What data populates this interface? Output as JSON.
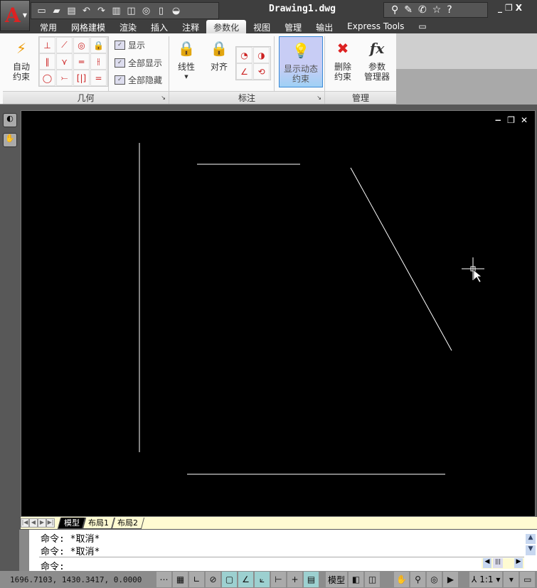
{
  "app": {
    "logo": "A",
    "title": "Drawing1.dwg"
  },
  "qat": {
    "icons": [
      "new-icon",
      "open-icon",
      "save-icon",
      "undo-icon",
      "redo-icon",
      "plot-icon",
      "publish-icon",
      "preview-icon",
      "properties-icon",
      "teapot-icon"
    ],
    "glyphs": [
      "▭",
      "▰",
      "▤",
      "↶",
      "↷",
      "▥",
      "◫",
      "◎",
      "▯",
      "◒"
    ]
  },
  "infobar": {
    "glyphs": [
      "⚲",
      "✎",
      "✆",
      "☆",
      "?"
    ]
  },
  "window": {
    "min": "_",
    "restore": "❐",
    "close": "X"
  },
  "tabs": [
    "常用",
    "网格建模",
    "渲染",
    "插入",
    "注释",
    "参数化",
    "视图",
    "管理",
    "输出",
    "Express Tools"
  ],
  "active_tab": "参数化",
  "ribbon": {
    "geometry": {
      "label": "几何",
      "auto": "自动\n约束",
      "show": "显示",
      "show_all": "全部显示",
      "hide_all": "全部隐藏",
      "grid": [
        "⊥",
        "⟋",
        "◎",
        "🔒",
        "∥",
        "⋎",
        "═",
        "⫲",
        "◯",
        "⤚",
        "[|]",
        "="
      ]
    },
    "dimension": {
      "label": "标注",
      "linear": "线性",
      "aligned": "对齐"
    },
    "show_dynamic": "显示动态\n约束",
    "manage": {
      "label": "管理",
      "delete": "删除\n约束",
      "params": "参数\n管理器",
      "fx": "fx"
    }
  },
  "viewport": {
    "min": "−",
    "restore": "❐",
    "close": "✕"
  },
  "layout_tabs": [
    "模型",
    "布局1",
    "布局2"
  ],
  "command": {
    "history": [
      "命令: *取消*",
      "命令: *取消*"
    ],
    "prompt": "命令:"
  },
  "status": {
    "coords": "1696.7103, 1430.3417, 0.0000",
    "model": "模型",
    "scale": "1:1"
  }
}
